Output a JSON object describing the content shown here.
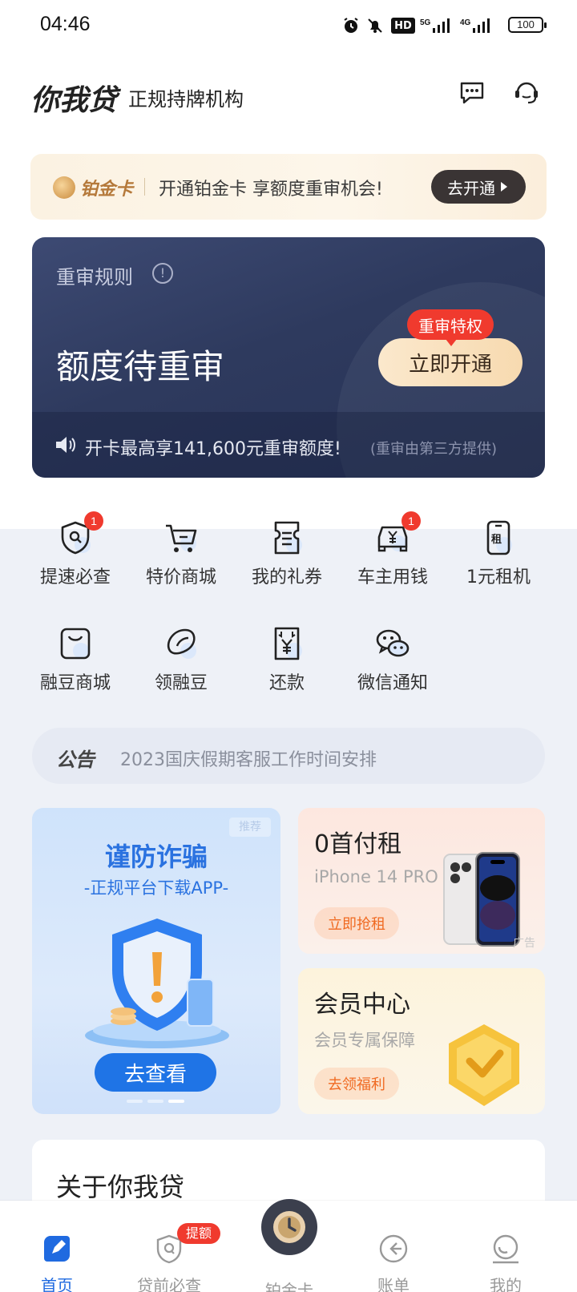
{
  "status_bar": {
    "time": "04:46",
    "battery": "100",
    "network1": "5G",
    "network2": "4G",
    "hd": "HD"
  },
  "header": {
    "brand": "你我贷",
    "subtitle": "正规持牌机构"
  },
  "platinum_banner": {
    "name": "铂金卡",
    "text": "开通铂金卡 享额度重审机会!",
    "button": "去开通"
  },
  "review_card": {
    "rule_label": "重审规则",
    "title": "额度待重审",
    "badge": "重审特权",
    "button": "立即开通",
    "promo": "开卡最高享141,600元重审额度!",
    "note": "(重审由第三方提供)"
  },
  "quick_grid": [
    {
      "label": "提速必查",
      "icon": "shield-search-icon",
      "badge": "1"
    },
    {
      "label": "特价商城",
      "icon": "cart-icon",
      "badge": ""
    },
    {
      "label": "我的礼券",
      "icon": "coupon-icon",
      "badge": ""
    },
    {
      "label": "车主用钱",
      "icon": "car-yen-icon",
      "badge": "1"
    },
    {
      "label": "1元租机",
      "icon": "phone-rent-icon",
      "badge": ""
    },
    {
      "label": "融豆商城",
      "icon": "bag-icon",
      "badge": ""
    },
    {
      "label": "领融豆",
      "icon": "bean-icon",
      "badge": ""
    },
    {
      "label": "还款",
      "icon": "repay-icon",
      "badge": ""
    },
    {
      "label": "微信通知",
      "icon": "wechat-icon",
      "badge": ""
    }
  ],
  "notice": {
    "tag": "公告",
    "text": "2023国庆假期客服工作时间安排"
  },
  "fraud_card": {
    "tag": "推荐",
    "title": "谨防诈骗",
    "subtitle": "-正规平台下载APP-",
    "button": "去查看"
  },
  "rent_card": {
    "title": "0首付租",
    "subtitle": "iPhone 14 PRO",
    "button": "立即抢租",
    "ad": "广告"
  },
  "vip_card": {
    "title": "会员中心",
    "subtitle": "会员专属保障",
    "button": "去领福利"
  },
  "about": {
    "title": "关于你我贷"
  },
  "tabbar": {
    "items": [
      {
        "label": "首页",
        "icon": "home-icon"
      },
      {
        "label": "贷前必查",
        "icon": "shield-check-icon",
        "badge": "提额"
      },
      {
        "label": "铂金卡",
        "icon": "platinum-card-icon"
      },
      {
        "label": "账单",
        "icon": "bill-icon"
      },
      {
        "label": "我的",
        "icon": "profile-icon"
      }
    ]
  },
  "colors": {
    "accent": "#1f6ae0",
    "badge_red": "#f03a2e",
    "dark_card": "#2e3a5e",
    "gold": "#b5793a"
  }
}
